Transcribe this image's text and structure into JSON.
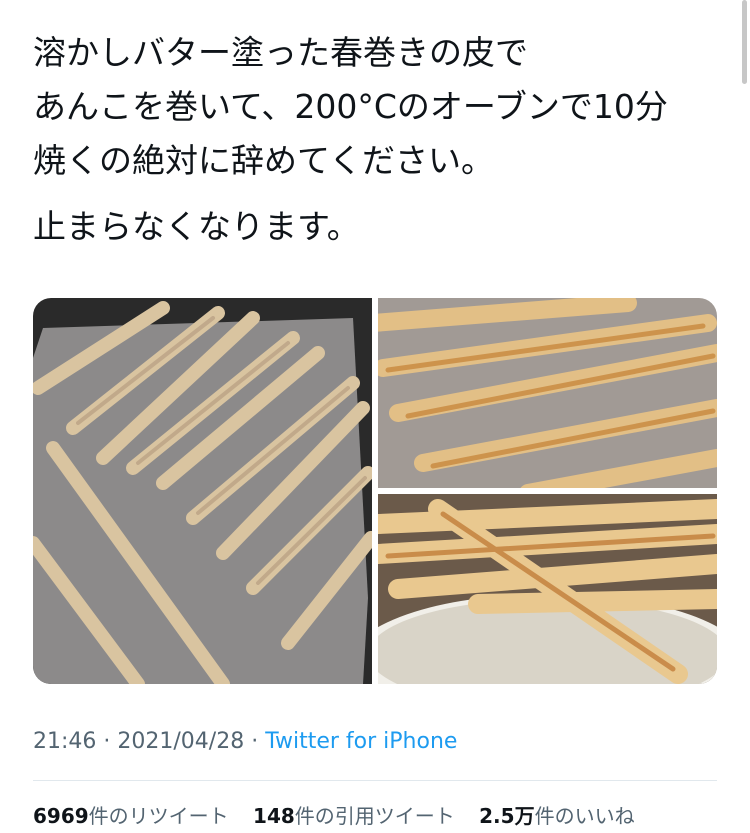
{
  "tweet": {
    "lines": [
      "溶かしバター塗った春巻きの皮で",
      "あんこを巻いて、200°Cのオーブンで10分",
      "焼くの絶対に辞めてください。",
      "止まらなくなります。"
    ]
  },
  "meta": {
    "time": "21:46",
    "separator": " · ",
    "date": "2021/04/28",
    "source": "Twitter for iPhone"
  },
  "stats": [
    {
      "count": "6969",
      "label": "件のリツイート"
    },
    {
      "count": "148",
      "label": "件の引用ツイート"
    },
    {
      "count": "2.5万",
      "label": "件のいいね"
    }
  ],
  "colors": {
    "text": "#0f1419",
    "secondary": "#536471",
    "link": "#1d9bf0",
    "divider": "#e1e8ed"
  }
}
